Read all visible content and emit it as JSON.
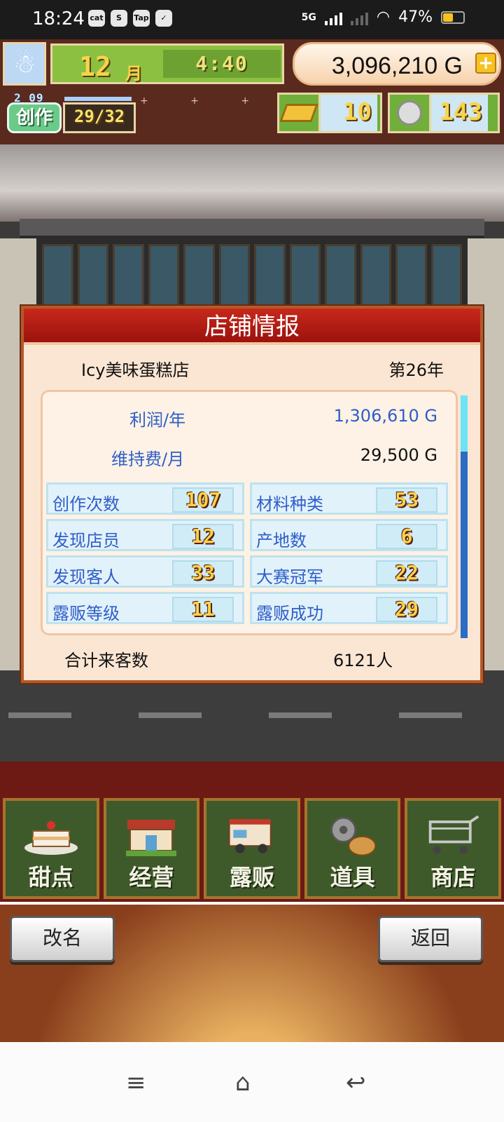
{
  "status_bar": {
    "time": "18:24",
    "app_icons": [
      "cat",
      "S",
      "Tap",
      "✓"
    ],
    "network": "5G",
    "battery": "47%"
  },
  "hud": {
    "month_number": "12",
    "month_unit": "月",
    "clock": "4:40",
    "gold": "3,096,210 G",
    "create": {
      "level": "2 09",
      "label": "创作",
      "count": "29/32"
    },
    "gold_bars": "10",
    "medals": "143"
  },
  "dialog": {
    "title": "店铺情报",
    "shop_name": "Icy美味蛋糕店",
    "year": "第26年",
    "profit_label": "利润/年",
    "profit_value": "1,306,610 G",
    "upkeep_label": "维持费/月",
    "upkeep_value": "29,500 G",
    "stats": [
      {
        "label": "创作次数",
        "value": "107"
      },
      {
        "label": "材料种类",
        "value": "53"
      },
      {
        "label": "发现店员",
        "value": "12"
      },
      {
        "label": "产地数",
        "value": "6"
      },
      {
        "label": "发现客人",
        "value": "33"
      },
      {
        "label": "大赛冠军",
        "value": "22"
      },
      {
        "label": "露贩等级",
        "value": "11"
      },
      {
        "label": "露贩成功",
        "value": "29"
      }
    ],
    "total_label": "合计来客数",
    "total_value": "6121人"
  },
  "menu": [
    "甜点",
    "经营",
    "露贩",
    "道具",
    "商店"
  ],
  "buttons": {
    "rename": "改名",
    "back": "返回"
  }
}
